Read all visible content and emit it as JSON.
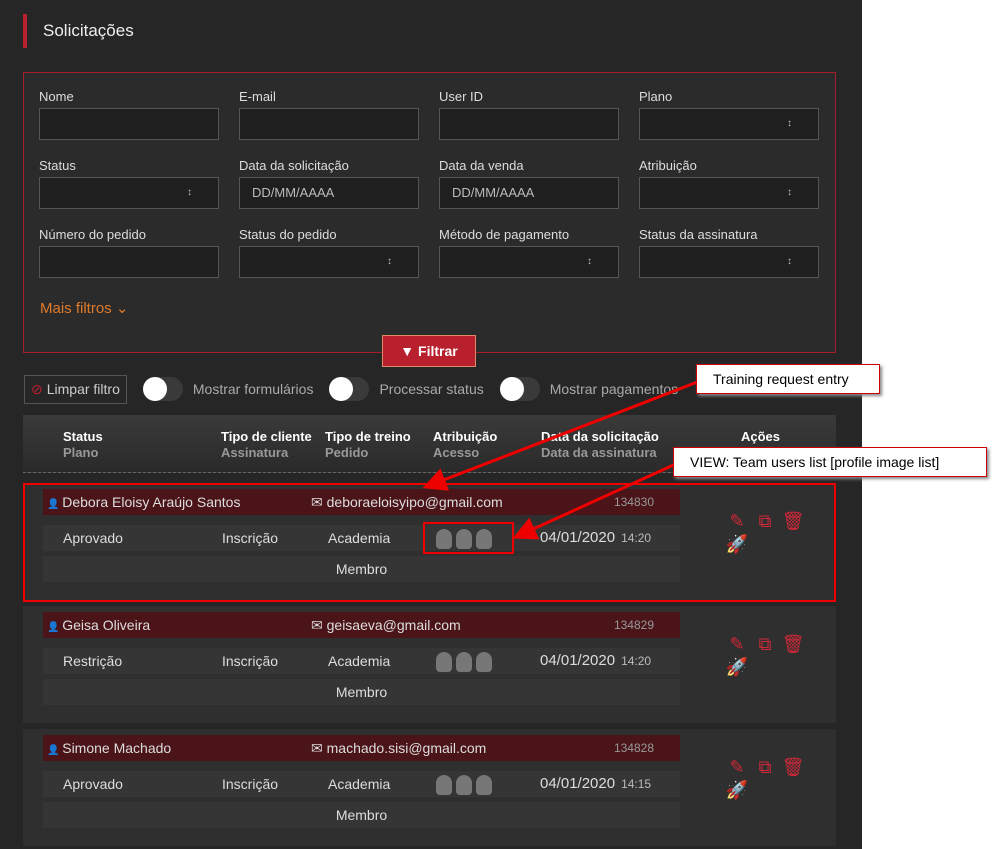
{
  "title": "Solicitações",
  "filters": [
    {
      "label": "Nome",
      "value": "",
      "select": false
    },
    {
      "label": "E-mail",
      "value": "",
      "select": false
    },
    {
      "label": "User ID",
      "value": "",
      "select": false
    },
    {
      "label": "Plano",
      "value": "",
      "select": true
    },
    {
      "label": "Status",
      "value": "",
      "select": true
    },
    {
      "label": "Data da solicitação",
      "value": "DD/MM/AAAA",
      "select": false
    },
    {
      "label": "Data da venda",
      "value": "DD/MM/AAAA",
      "select": false
    },
    {
      "label": "Atribuição",
      "value": "",
      "select": true
    },
    {
      "label": "Número do pedido",
      "value": "",
      "select": false
    },
    {
      "label": "Status do pedido",
      "value": "",
      "select": true
    },
    {
      "label": "Método de pagamento",
      "value": "",
      "select": true
    },
    {
      "label": "Status da assinatura",
      "value": "",
      "select": true
    }
  ],
  "more_filters": "Mais filtros ⌄",
  "filter_button": "Filtrar",
  "clear_filter": "Limpar filtro",
  "toggles": [
    "Mostrar formulários",
    "Processar status",
    "Mostrar pagamentos"
  ],
  "headers": [
    {
      "a": "Status",
      "b": "Plano"
    },
    {
      "a": "Tipo de cliente",
      "b": "Assinatura"
    },
    {
      "a": "Tipo de treino",
      "b": "Pedido"
    },
    {
      "a": "Atribuição",
      "b": "Acesso"
    },
    {
      "a": "Data da solicitação",
      "b": "Data da assinatura"
    },
    {
      "a": "Ações",
      "b": ""
    }
  ],
  "entries": [
    {
      "name": "Debora Eloisy Araújo Santos",
      "email": "deboraeloisyipo@gmail.com",
      "id": "134830",
      "status": "Aprovado",
      "client": "Inscrição",
      "training": "Academia",
      "date": "04/01/2020",
      "time": "14:20",
      "plan": "Membro"
    },
    {
      "name": "Geisa Oliveira",
      "email": "geisaeva@gmail.com",
      "id": "134829",
      "status": "Restrição",
      "client": "Inscrição",
      "training": "Academia",
      "date": "04/01/2020",
      "time": "14:20",
      "plan": "Membro"
    },
    {
      "name": "Simone Machado",
      "email": "machado.sisi@gmail.com",
      "id": "134828",
      "status": "Aprovado",
      "client": "Inscrição",
      "training": "Academia",
      "date": "04/01/2020",
      "time": "14:15",
      "plan": "Membro"
    }
  ],
  "annotations": {
    "entry": "Training request entry",
    "view": "VIEW: Team users list [profile image list]"
  }
}
